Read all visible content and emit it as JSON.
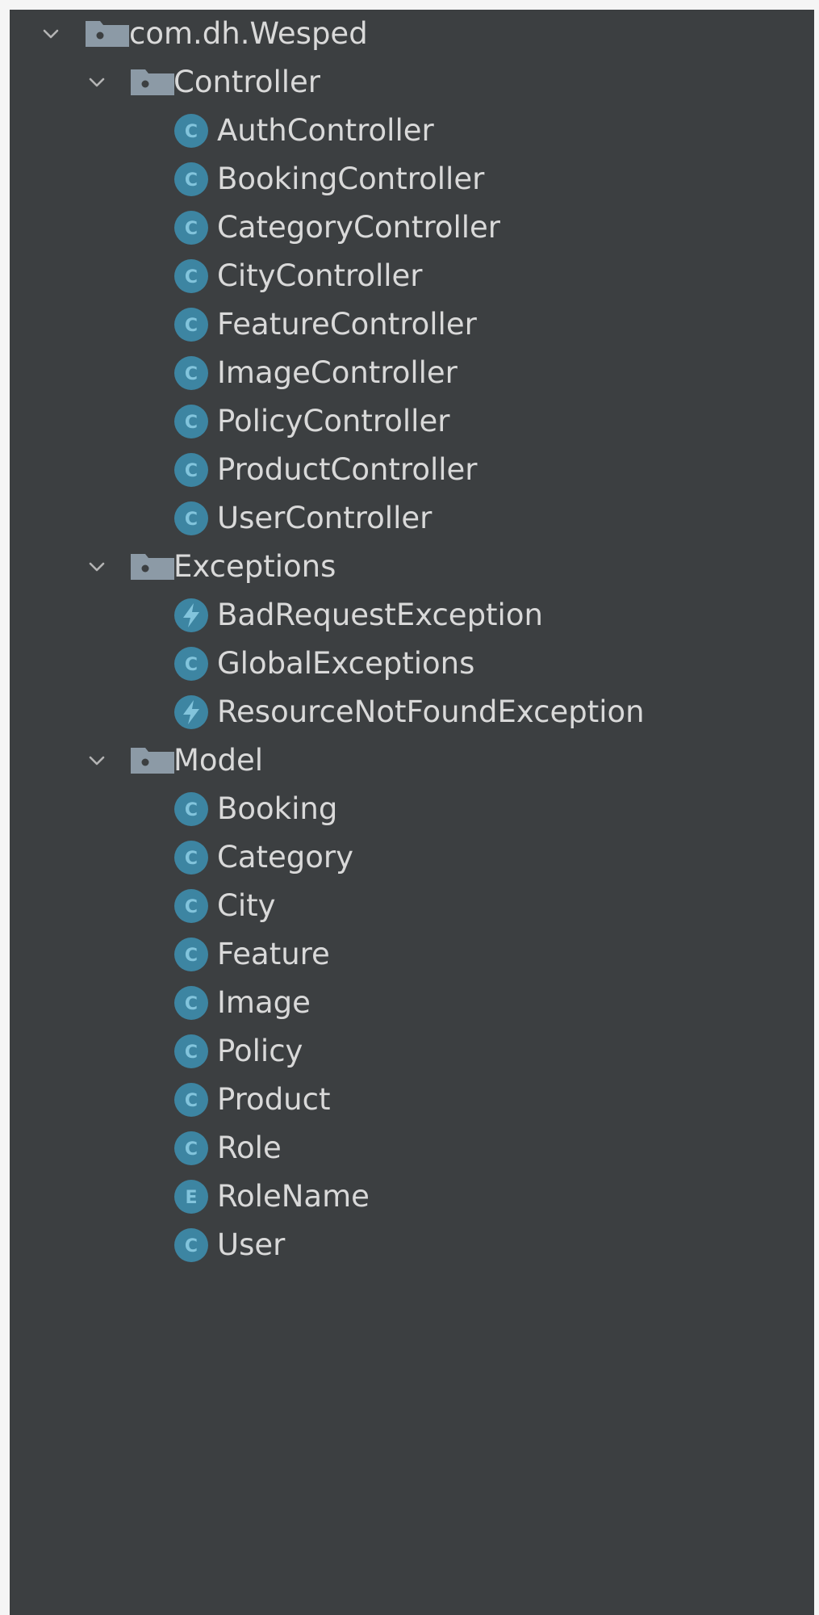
{
  "tree": {
    "root": {
      "label": "com.dh.Wesped",
      "icon": "package-folder-icon",
      "expanded": true
    },
    "packages": [
      {
        "label": "Controller",
        "icon": "package-folder-icon",
        "expanded": true,
        "items": [
          {
            "label": "AuthController",
            "kind": "class",
            "icon_letter": "C"
          },
          {
            "label": "BookingController",
            "kind": "class",
            "icon_letter": "C"
          },
          {
            "label": "CategoryController",
            "kind": "class",
            "icon_letter": "C"
          },
          {
            "label": "CityController",
            "kind": "class",
            "icon_letter": "C"
          },
          {
            "label": "FeatureController",
            "kind": "class",
            "icon_letter": "C"
          },
          {
            "label": "ImageController",
            "kind": "class",
            "icon_letter": "C"
          },
          {
            "label": "PolicyController",
            "kind": "class",
            "icon_letter": "C"
          },
          {
            "label": "ProductController",
            "kind": "class",
            "icon_letter": "C"
          },
          {
            "label": "UserController",
            "kind": "class",
            "icon_letter": "C"
          }
        ]
      },
      {
        "label": "Exceptions",
        "icon": "package-folder-icon",
        "expanded": true,
        "items": [
          {
            "label": "BadRequestException",
            "kind": "exception"
          },
          {
            "label": "GlobalExceptions",
            "kind": "class",
            "icon_letter": "C"
          },
          {
            "label": "ResourceNotFoundException",
            "kind": "exception"
          }
        ]
      },
      {
        "label": "Model",
        "icon": "package-folder-icon",
        "expanded": true,
        "items": [
          {
            "label": "Booking",
            "kind": "class",
            "icon_letter": "C"
          },
          {
            "label": "Category",
            "kind": "class",
            "icon_letter": "C"
          },
          {
            "label": "City",
            "kind": "class",
            "icon_letter": "C"
          },
          {
            "label": "Feature",
            "kind": "class",
            "icon_letter": "C"
          },
          {
            "label": "Image",
            "kind": "class",
            "icon_letter": "C"
          },
          {
            "label": "Policy",
            "kind": "class",
            "icon_letter": "C"
          },
          {
            "label": "Product",
            "kind": "class",
            "icon_letter": "C"
          },
          {
            "label": "Role",
            "kind": "class",
            "icon_letter": "C"
          },
          {
            "label": "RoleName",
            "kind": "enum",
            "icon_letter": "E"
          },
          {
            "label": "User",
            "kind": "class",
            "icon_letter": "C"
          }
        ]
      }
    ]
  },
  "colors": {
    "panel_bg": "#3c3f41",
    "text": "#d9d9d9",
    "folder": "#8c9aa6",
    "chevron": "#b4b4b4",
    "class_icon": "#3d85a2",
    "class_icon_inner": "#82c4dc"
  }
}
